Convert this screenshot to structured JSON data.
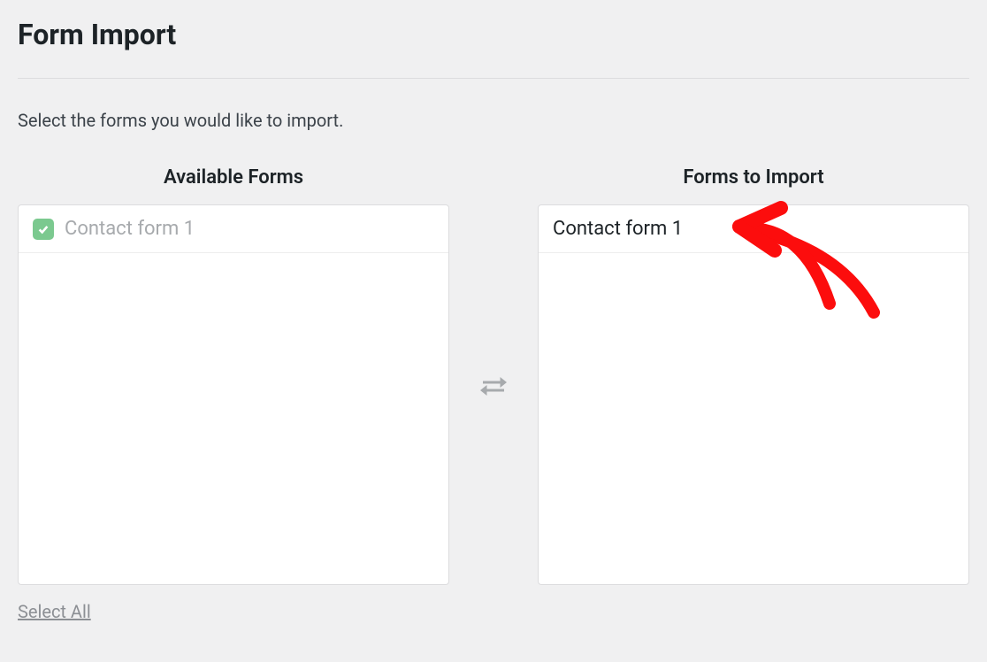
{
  "page": {
    "title": "Form Import",
    "description": "Select the forms you would like to import."
  },
  "columns": {
    "available": {
      "header": "Available Forms",
      "items": [
        {
          "label": "Contact form 1",
          "checked": true
        }
      ]
    },
    "toImport": {
      "header": "Forms to Import",
      "items": [
        {
          "label": "Contact form 1"
        }
      ]
    }
  },
  "actions": {
    "selectAll": "Select All"
  }
}
